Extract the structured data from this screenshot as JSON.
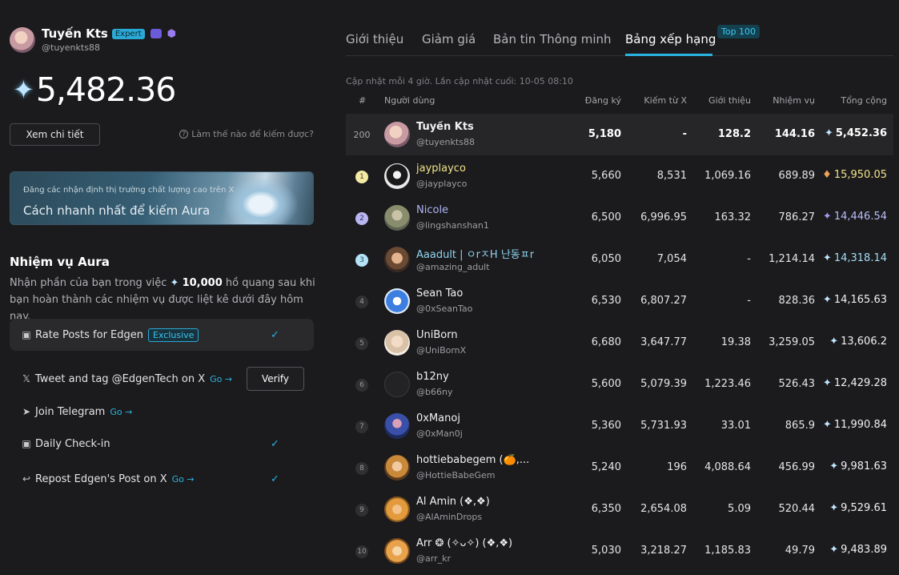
{
  "profile": {
    "name": "Tuyến Kts",
    "badge": "Expert",
    "handle": "@tuyenkts88"
  },
  "balance": {
    "value": "5,482.36"
  },
  "actions": {
    "detail_label": "Xem chi tiết",
    "how_earn": "Làm thế nào để kiếm được?"
  },
  "banner": {
    "subtitle": "Đăng các nhận định thị trường chất lượng cao trên X",
    "title": "Cách nhanh nhất để kiếm Aura"
  },
  "tasks": {
    "title": "Nhiệm vụ Aura",
    "desc_pre": "Nhận phần của bạn trong việc",
    "desc_amount": "10,000",
    "desc_post": "hồ quang sau khi bạn hoàn thành các nhiệm vụ được liệt kê dưới đây hôm nay.",
    "items": [
      {
        "label": "Rate Posts for Edgen",
        "tag": "Exclusive"
      },
      {
        "label": "Tweet and tag @EdgenTech on X",
        "go": "Go →",
        "action": "Verify"
      },
      {
        "label": "Join Telegram",
        "go": "Go →"
      },
      {
        "label": "Daily Check-in"
      },
      {
        "label": "Repost Edgen's Post on X",
        "go": "Go →"
      }
    ]
  },
  "tabs": [
    {
      "label": "Giới thiệu"
    },
    {
      "label": "Giảm giá"
    },
    {
      "label": "Bản tin Thông minh"
    },
    {
      "label": "Bảng xếp hạng"
    }
  ],
  "tab_badge": "Top 100",
  "updated": "Cập nhật mỗi 4 giờ. Lần cập nhật cuối: 10-05 08:10",
  "table": {
    "headers": {
      "rank": "#",
      "user": "Người dùng",
      "reg": "Đăng ký",
      "x": "Kiếm từ X",
      "ref": "Giới thiệu",
      "task": "Nhiệm vụ",
      "total": "Tổng cộng"
    },
    "me": {
      "rank": "200",
      "name": "Tuyến Kts",
      "handle": "@tuyenkts88",
      "reg": "5,180",
      "x": "-",
      "ref": "128.2",
      "task": "144.16",
      "total": "5,452.36"
    },
    "rows": [
      {
        "rank": "1",
        "name": "jayplayco",
        "handle": "@jayplayco",
        "reg": "5,660",
        "x": "8,531",
        "ref": "1,069.16",
        "task": "689.89",
        "total": "15,950.05"
      },
      {
        "rank": "2",
        "name": "Nicole",
        "handle": "@lingshanshan1",
        "reg": "6,500",
        "x": "6,996.95",
        "ref": "163.32",
        "task": "786.27",
        "total": "14,446.54"
      },
      {
        "rank": "3",
        "name": "Aaadult | ㅇrㅈH 난동ㅍr",
        "handle": "@amazing_adult",
        "reg": "6,050",
        "x": "7,054",
        "ref": "-",
        "task": "1,214.14",
        "total": "14,318.14"
      },
      {
        "rank": "4",
        "name": "Sean Tao",
        "handle": "@0xSeanTao",
        "reg": "6,530",
        "x": "6,807.27",
        "ref": "-",
        "task": "828.36",
        "total": "14,165.63"
      },
      {
        "rank": "5",
        "name": "UniBorn",
        "handle": "@UniBornX",
        "reg": "6,680",
        "x": "3,647.77",
        "ref": "19.38",
        "task": "3,259.05",
        "total": "13,606.2"
      },
      {
        "rank": "6",
        "name": "b12ny",
        "handle": "@b66ny",
        "reg": "5,600",
        "x": "5,079.39",
        "ref": "1,223.46",
        "task": "526.43",
        "total": "12,429.28"
      },
      {
        "rank": "7",
        "name": "0xManoj",
        "handle": "@0xMan0j",
        "reg": "5,360",
        "x": "5,731.93",
        "ref": "33.01",
        "task": "865.9",
        "total": "11,990.84"
      },
      {
        "rank": "8",
        "name": "hottiebabegem (🍊,...",
        "handle": "@HottieBabeGem",
        "reg": "5,240",
        "x": "196",
        "ref": "4,088.64",
        "task": "456.99",
        "total": "9,981.63"
      },
      {
        "rank": "9",
        "name": "Al Amin (❖,❖)",
        "handle": "@AlAminDrops",
        "reg": "6,350",
        "x": "2,654.08",
        "ref": "5.09",
        "task": "520.44",
        "total": "9,529.61"
      },
      {
        "rank": "10",
        "name": "Arr ❂ (✧ᴗ✧) (❖,❖)",
        "handle": "@arr_kr",
        "reg": "5,030",
        "x": "3,218.27",
        "ref": "1,185.83",
        "task": "49.79",
        "total": "9,483.89"
      }
    ]
  },
  "colors": {
    "accent": "#2ab3e0",
    "gold": "#f0e38a",
    "silver": "#aeb4f5",
    "bronze": "#8fd3f0"
  }
}
